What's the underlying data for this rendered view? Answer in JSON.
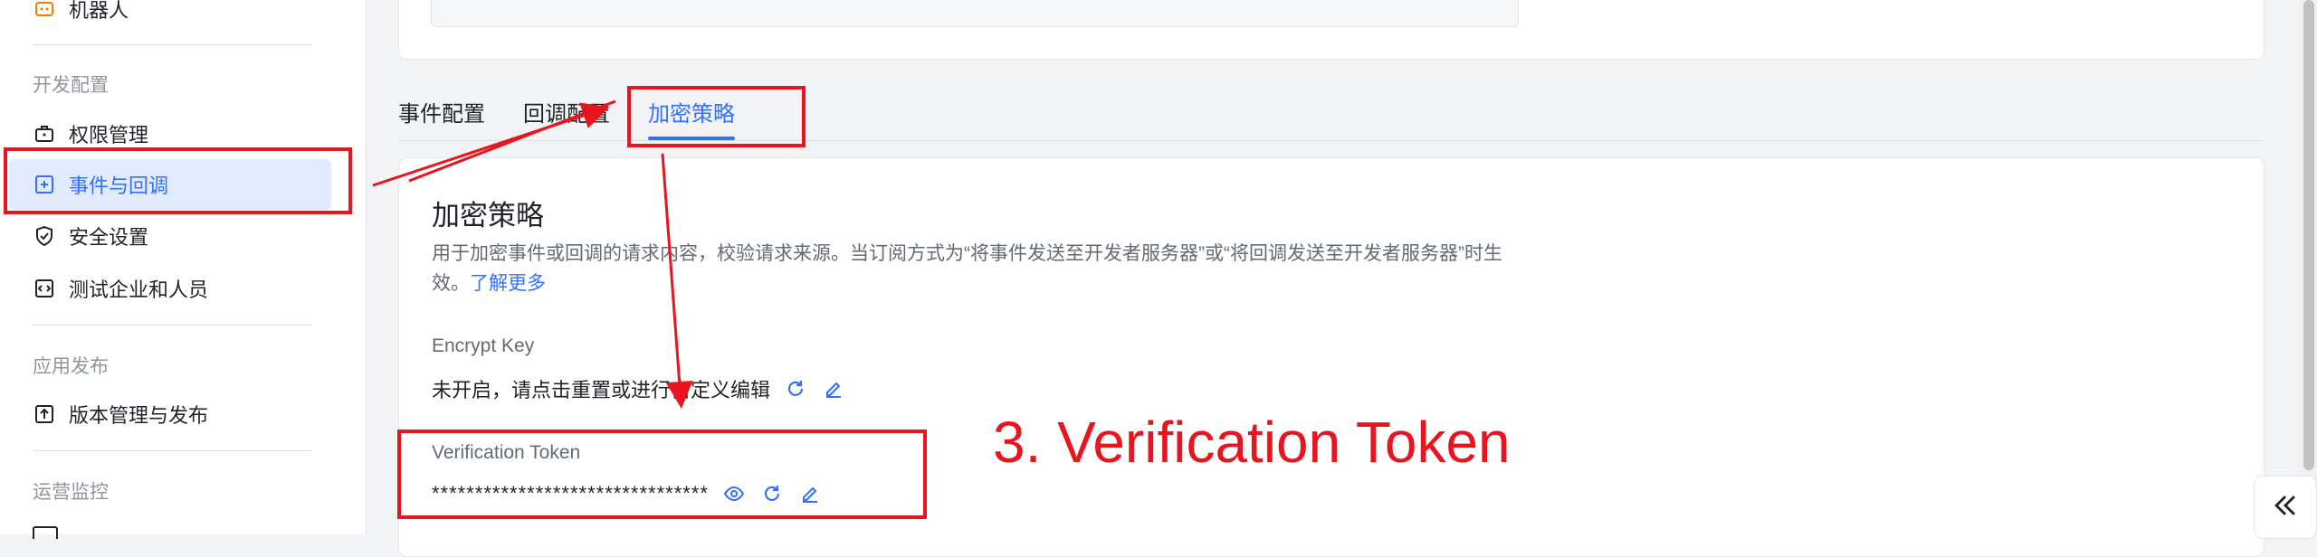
{
  "sidebar": {
    "top_item": "机器人",
    "groups": [
      {
        "title": "开发配置",
        "items": [
          "权限管理",
          "事件与回调",
          "安全设置",
          "测试企业和人员"
        ]
      },
      {
        "title": "应用发布",
        "items": [
          "版本管理与发布"
        ]
      },
      {
        "title": "运营监控",
        "items": []
      }
    ],
    "active_item": "事件与回调"
  },
  "tabs": [
    "事件配置",
    "回调配置",
    "加密策略"
  ],
  "active_tab": "加密策略",
  "section": {
    "title": "加密策略",
    "description": "用于加密事件或回调的请求内容，校验请求来源。当订阅方式为“将事件发送至开发者服务器”或“将回调发送至开发者服务器”时生效。",
    "learn_more": "了解更多"
  },
  "encrypt_key": {
    "label": "Encrypt Key",
    "value": "未开启，请点击重置或进行自定义编辑"
  },
  "verification_token": {
    "label": "Verification Token",
    "value": "********************************"
  },
  "annotation": {
    "text": "3. Verification Token",
    "color": "#e8141e"
  },
  "colors": {
    "accent": "#3370ff",
    "active_bg": "#e1eaff"
  }
}
